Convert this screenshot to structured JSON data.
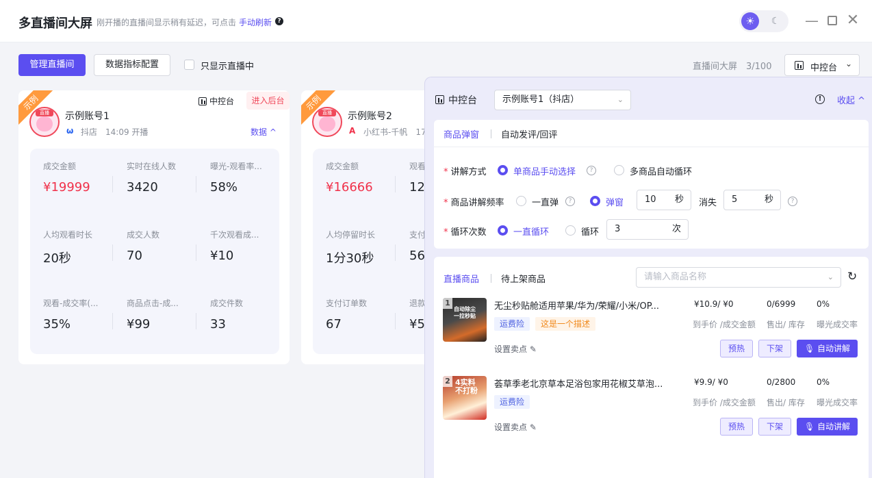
{
  "app": {
    "title": "多直播间大屏",
    "subtitle": "刚开播的直播间显示稍有延迟，可点击",
    "refresh_link": "手动刷新",
    "help_icon": "?"
  },
  "window": {
    "minimize": "—",
    "close": "✕",
    "sun_icon": "☀",
    "moon_icon": "☾"
  },
  "toolbar": {
    "manage_button": "管理直播间",
    "config_button": "数据指标配置",
    "only_live_label": "只显示直播中",
    "screen_count": "直播间大屏　3/100",
    "control_select": "中控台",
    "chevron": "⌄"
  },
  "cards": [
    {
      "ribbon": "示例",
      "control_label": "中控台",
      "enter_backend": "进入后台",
      "avatar_tag": "直播",
      "account_name": "示例账号1",
      "platform_icon": "ω",
      "platform_text": "抖店　14:09 开播",
      "data_link": "数据 ^",
      "metrics": [
        {
          "label": "成交金额",
          "value": "¥19999",
          "highlight": true
        },
        {
          "label": "实时在线人数",
          "value": "3420"
        },
        {
          "label": "曝光-观看率...",
          "value": "58%"
        },
        {
          "label": "人均观看时长",
          "value": "20秒"
        },
        {
          "label": "成交人数",
          "value": "70"
        },
        {
          "label": "千次观看成...",
          "value": "¥10"
        },
        {
          "label": "观看-成交率(...",
          "value": "35%"
        },
        {
          "label": "商品点击-成...",
          "value": "¥99"
        },
        {
          "label": "成交件数",
          "value": "33"
        }
      ]
    },
    {
      "ribbon": "示例",
      "avatar_tag": "直播",
      "account_name": "示例账号2",
      "platform_icon": "A",
      "platform_text": "小红书-千帆　17",
      "metrics": [
        {
          "label": "成交金额",
          "value": "¥16666",
          "highlight": true
        },
        {
          "label": "观看",
          "value": "12"
        },
        {
          "label": "人均停留时长",
          "value": "1分30秒"
        },
        {
          "label": "支付",
          "value": "56"
        },
        {
          "label": "支付订单数",
          "value": "67"
        },
        {
          "label": "退款",
          "value": "¥5"
        }
      ]
    }
  ],
  "panel": {
    "title": "中控台",
    "account_select": "示例账号1（抖店）",
    "info_icon": "!",
    "collapse": "收起 ^",
    "section1_tabs": [
      "商品弹窗",
      "自动发评/回评"
    ],
    "explain_mode": {
      "label": "讲解方式",
      "opt1": "单商品手动选择",
      "opt2": "多商品自动循环"
    },
    "frequency": {
      "label": "商品讲解频率",
      "opt1": "一直弹",
      "opt2": "弹窗",
      "popup_value": "10",
      "popup_unit": "秒",
      "vanish_label": "消失",
      "vanish_value": "5",
      "vanish_unit": "秒"
    },
    "loop": {
      "label": "循环次数",
      "opt1": "一直循环",
      "opt2": "循环",
      "value": "3",
      "unit": "次"
    },
    "question_icon": "?",
    "required_mark": "*",
    "section2_tabs": [
      "直播商品",
      "待上架商品"
    ],
    "search_placeholder": "请输入商品名称",
    "refresh_icon": "↻",
    "products": [
      {
        "index": "1",
        "thumb_text": "自动除尘\n一拉秒贴",
        "title": "无尘秒贴舱适用苹果/华为/荣耀/小米/OP...",
        "tags": [
          "运费险",
          "这是一个描述"
        ],
        "price": "¥10.9/ ¥0",
        "sales": "0/6999",
        "rate": "0%",
        "price_label": "到手价 /成交金额",
        "sales_label": "售出/ 库存",
        "rate_label": "曝光成交率",
        "set_selling": "设置卖点 ✎",
        "warmup": "预热",
        "offshelf": "下架",
        "auto_explain": "🎙 自动讲解"
      },
      {
        "index": "2",
        "thumb_text": "4实料\n不打粉",
        "title": "荟草季老北京草本足浴包家用花椒艾草泡...",
        "tags": [
          "运费险"
        ],
        "price": "¥9.9/ ¥0",
        "sales": "0/2800",
        "rate": "0%",
        "price_label": "到手价 /成交金额",
        "sales_label": "售出/ 库存",
        "rate_label": "曝光成交率",
        "set_selling": "设置卖点 ✎",
        "warmup": "预热",
        "offshelf": "下架",
        "auto_explain": "🎙 自动讲解"
      }
    ]
  }
}
